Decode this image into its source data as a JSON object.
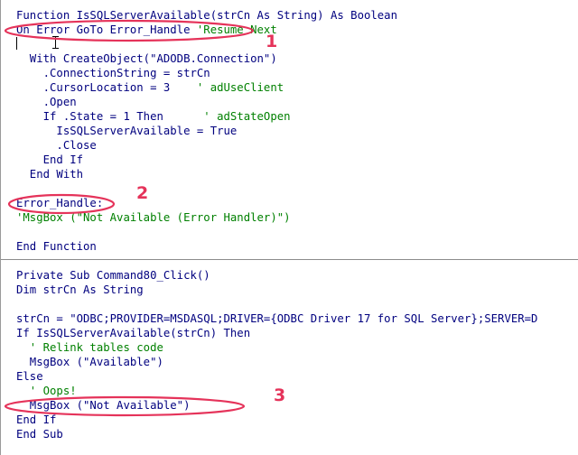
{
  "editor": {
    "module_lines": [
      [
        {
          "t": "Function IsSQLServerAvailable(strCn As String) As Boolean",
          "c": "plain"
        }
      ],
      [
        {
          "t": "On Error GoTo Error_Handle ",
          "c": "plain"
        },
        {
          "t": "'Resume Next",
          "c": "comment"
        }
      ],
      [
        {
          "t": "",
          "c": "plain"
        }
      ],
      [
        {
          "t": "  With CreateObject(\"ADODB.Connection\")",
          "c": "plain"
        }
      ],
      [
        {
          "t": "    .ConnectionString = strCn",
          "c": "plain"
        }
      ],
      [
        {
          "t": "    .CursorLocation = 3    ",
          "c": "plain"
        },
        {
          "t": "' adUseClient",
          "c": "comment"
        }
      ],
      [
        {
          "t": "    .Open",
          "c": "plain"
        }
      ],
      [
        {
          "t": "    If .State = 1 Then      ",
          "c": "plain"
        },
        {
          "t": "' adStateOpen",
          "c": "comment"
        }
      ],
      [
        {
          "t": "      IsSQLServerAvailable = True",
          "c": "plain"
        }
      ],
      [
        {
          "t": "      .Close",
          "c": "plain"
        }
      ],
      [
        {
          "t": "    End If",
          "c": "plain"
        }
      ],
      [
        {
          "t": "  End With",
          "c": "plain"
        }
      ],
      [
        {
          "t": "",
          "c": "plain"
        }
      ],
      [
        {
          "t": "Error_Handle:",
          "c": "plain"
        }
      ],
      [
        {
          "t": "'MsgBox (\"Not Available (Error Handler)\")",
          "c": "comment"
        }
      ],
      [
        {
          "t": "",
          "c": "plain"
        }
      ],
      [
        {
          "t": "End Function",
          "c": "plain"
        }
      ]
    ],
    "sub_lines": [
      [
        {
          "t": "Private Sub Command80_Click()",
          "c": "plain"
        }
      ],
      [
        {
          "t": "Dim strCn As String",
          "c": "plain"
        }
      ],
      [
        {
          "t": "",
          "c": "plain"
        }
      ],
      [
        {
          "t": "strCn = \"ODBC;PROVIDER=MSDASQL;DRIVER={ODBC Driver 17 for SQL Server};SERVER=D",
          "c": "plain"
        }
      ],
      [
        {
          "t": "If IsSQLServerAvailable(strCn) Then",
          "c": "plain"
        }
      ],
      [
        {
          "t": "  ' Relink tables code",
          "c": "comment"
        }
      ],
      [
        {
          "t": "  MsgBox (\"Available\")",
          "c": "plain"
        }
      ],
      [
        {
          "t": "Else",
          "c": "plain"
        }
      ],
      [
        {
          "t": "  ' Oops!",
          "c": "comment"
        }
      ],
      [
        {
          "t": "  MsgBox (\"Not Available\")",
          "c": "plain"
        }
      ],
      [
        {
          "t": "End If",
          "c": "plain"
        }
      ],
      [
        {
          "t": "End Sub",
          "c": "plain"
        }
      ]
    ]
  },
  "annotations": {
    "callout_1": "1",
    "callout_2": "2",
    "callout_3": "3",
    "color": "#e5335a"
  },
  "colors": {
    "keyword": "#00007f",
    "comment": "#008000",
    "background": "#ffffff"
  }
}
